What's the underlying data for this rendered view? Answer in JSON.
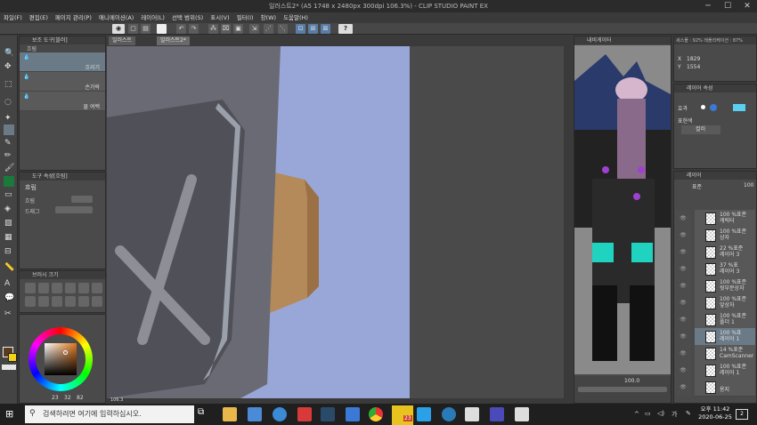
{
  "window": {
    "title": "일러스트2* (A5 1748 x 2480px 300dpi 106.3%) - CLIP STUDIO PAINT EX"
  },
  "menu": [
    "파일(F)",
    "편집(E)",
    "페이지 관리(P)",
    "애니메이션(A)",
    "레이어(L)",
    "선택 범위(S)",
    "표시(V)",
    "필터(I)",
    "창(W)",
    "도움말(H)"
  ],
  "tabs": [
    "일러스트",
    "일러스트2*"
  ],
  "sub_tool": {
    "header": "보조 도구[블러]",
    "group": "흐림",
    "items": [
      "흐리기",
      "손가락",
      "물 여백"
    ],
    "sub_labels": [
      "흐리기",
      "손가락",
      "물 여백"
    ]
  },
  "tool_property": {
    "header": "도구 속성[흐림]",
    "name": "흐림",
    "rows": [
      "흐림",
      "드래그"
    ]
  },
  "brush_size": {
    "header": "브러시 크기"
  },
  "color_values": [
    "23",
    "32",
    "82"
  ],
  "colors": {
    "main": "#5a3a20",
    "sub": "#f2d21a",
    "accent": "#e8c31e"
  },
  "navigator": {
    "header": "내비게이터",
    "readout": [
      "1829",
      "1554"
    ],
    "labels": [
      "X",
      "Y"
    ],
    "meta": "세스몰 : 92% 레플리케이션 : 87%"
  },
  "layer_property": {
    "header": "레이어 속성",
    "effect": "효과",
    "expression": "표현색",
    "expression_value": "컬러"
  },
  "layers": {
    "header": "레이어",
    "blend": "표준",
    "opacity": "100",
    "items": [
      {
        "pct": "100 %표준",
        "name": "캐릭터"
      },
      {
        "pct": "100 %표준",
        "name": "상자"
      },
      {
        "pct": "22 %표준",
        "name": "레이어 3"
      },
      {
        "pct": "37 %표",
        "name": "레이어 3"
      },
      {
        "pct": "100 %표준",
        "name": "뒷부분상자"
      },
      {
        "pct": "100 %표준",
        "name": "앞상자"
      },
      {
        "pct": "100 %표준",
        "name": "폴더 1"
      },
      {
        "pct": "100 %표",
        "name": "레이어 1"
      },
      {
        "pct": "14 %표준",
        "name": "CamScanner"
      },
      {
        "pct": "100 %표준",
        "name": "레이어 1"
      },
      {
        "pct": "",
        "name": "용지"
      }
    ]
  },
  "status": {
    "zoom": "106.3",
    "nav_zoom": "100.0"
  },
  "taskbar": {
    "search_placeholder": "검색하려면 여기에 입력하십시오.",
    "time": "오후 11:42",
    "date": "2020-06-25",
    "badge": "23",
    "notif": "2"
  }
}
